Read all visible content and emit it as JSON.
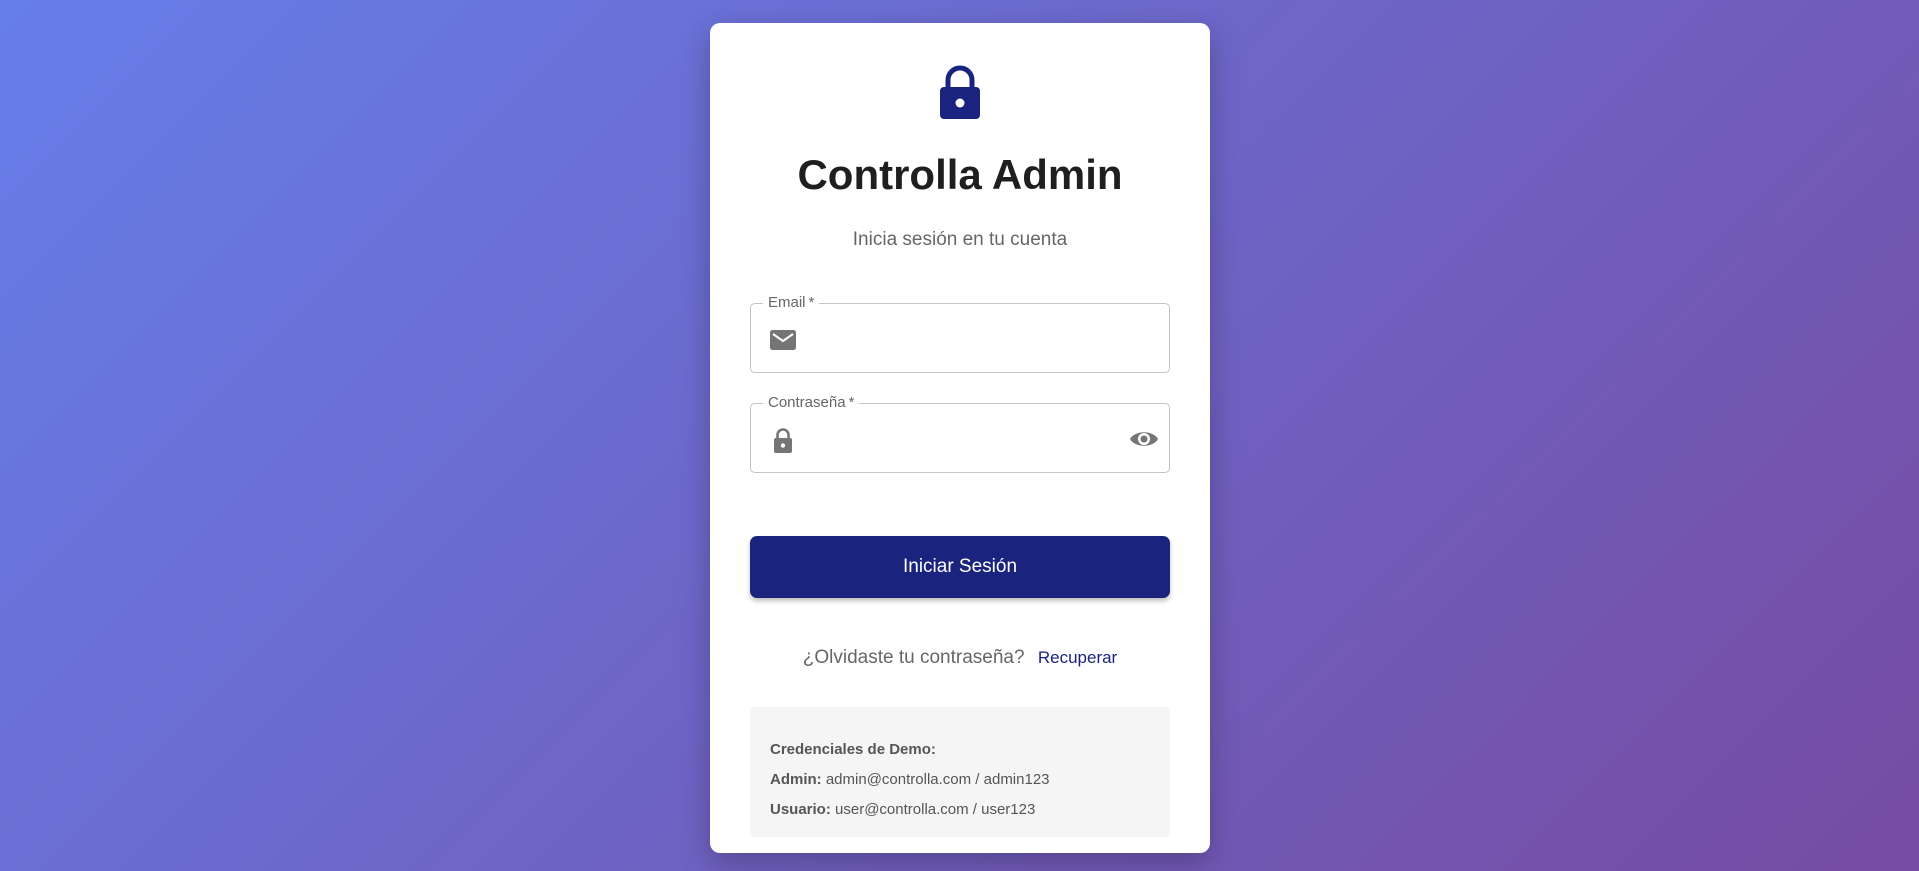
{
  "header": {
    "icon": "lock-icon",
    "title": "Controlla Admin",
    "subtitle": "Inicia sesión en tu cuenta"
  },
  "form": {
    "email": {
      "label": "Email",
      "required_mark": "*",
      "value": "",
      "icon": "mail-icon"
    },
    "password": {
      "label": "Contraseña",
      "required_mark": "*",
      "value": "",
      "icon": "lock-icon",
      "toggle_icon": "eye-icon"
    },
    "submit_label": "Iniciar Sesión"
  },
  "forgot": {
    "text": "¿Olvidaste tu contraseña?",
    "link_label": "Recuperar"
  },
  "demo": {
    "heading": "Credenciales de Demo:",
    "admin_label": "Admin:",
    "admin_value": "admin@controlla.com / admin123",
    "user_label": "Usuario:",
    "user_value": "user@controlla.com / user123"
  },
  "colors": {
    "primary": "#1a237e",
    "background_start": "#667eea",
    "background_end": "#764ba2",
    "icon_gray": "#757575"
  }
}
